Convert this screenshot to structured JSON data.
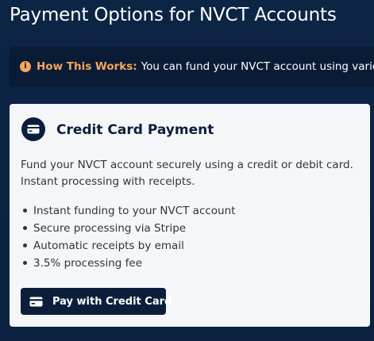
{
  "page": {
    "title": "Payment Options for NVCT Accounts"
  },
  "info_banner": {
    "icon": "info-icon",
    "icon_glyph": "i",
    "label": "How This Works:",
    "text": "You can fund your NVCT account using various p"
  },
  "credit_card_section": {
    "icon": "credit-card-icon",
    "title": "Credit Card Payment",
    "description": "Fund your NVCT account securely using a credit or debit card. Instant processing with receipts.",
    "features": [
      "Instant funding to your NVCT account",
      "Secure processing via Stripe",
      "Automatic receipts by email",
      "3.5% processing fee"
    ],
    "button": {
      "icon": "credit-card-icon",
      "label": "Pay with Credit Card"
    }
  },
  "colors": {
    "background": "#0d2545",
    "banner_background": "#0a1b36",
    "accent_orange": "#f5a65b",
    "card_background": "#f5f6f8",
    "navy": "#0b1f3b"
  }
}
